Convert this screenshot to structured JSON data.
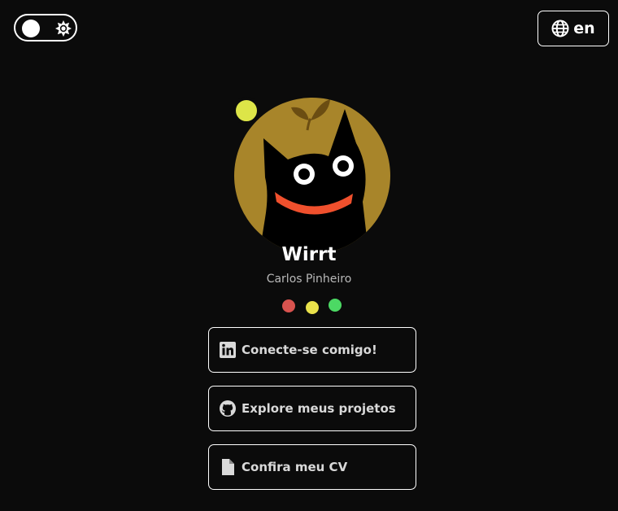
{
  "header": {
    "theme_toggle": {
      "state": "dark",
      "knob_icon": "circle",
      "icon": "sun-icon"
    },
    "language": {
      "label": "en",
      "icon": "globe-icon"
    }
  },
  "profile": {
    "nickname": "Wirrt",
    "full_name": "Carlos Pinheiro",
    "avatar": "black-cat-with-sprout-avatar",
    "status_color": "#dde548",
    "dots": [
      "#d9534f",
      "#e9e14b",
      "#4cd964"
    ]
  },
  "links": [
    {
      "label": "Conecte-se comigo!",
      "icon": "linkedin-icon"
    },
    {
      "label": "Explore meus projetos",
      "icon": "github-icon"
    },
    {
      "label": "Confira meu CV",
      "icon": "document-icon"
    }
  ]
}
